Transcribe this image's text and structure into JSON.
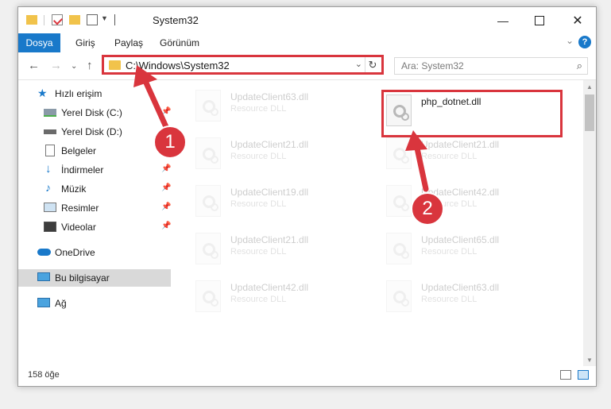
{
  "window": {
    "title": "System32"
  },
  "ribbon": {
    "tabs": [
      "Dosya",
      "Giriş",
      "Paylaş",
      "Görünüm"
    ],
    "help_label": "?"
  },
  "address": {
    "path": "C:\\Windows\\System32",
    "search_placeholder": "Ara: System32"
  },
  "nav": {
    "items": [
      {
        "label": "Hızlı erişim",
        "icon": "star-icon",
        "pinned": false
      },
      {
        "label": "Yerel Disk (C:)",
        "icon": "drive-icon",
        "pinned": true
      },
      {
        "label": "Yerel Disk (D:)",
        "icon": "drive-icon",
        "pinned": false
      },
      {
        "label": "Belgeler",
        "icon": "documents-icon",
        "pinned": true
      },
      {
        "label": "İndirmeler",
        "icon": "download-icon",
        "pinned": true
      },
      {
        "label": "Müzik",
        "icon": "music-icon",
        "pinned": true
      },
      {
        "label": "Resimler",
        "icon": "pictures-icon",
        "pinned": true
      },
      {
        "label": "Videolar",
        "icon": "videos-icon",
        "pinned": true
      },
      {
        "label": "OneDrive",
        "icon": "onedrive-icon",
        "pinned": false
      },
      {
        "label": "Bu bilgisayar",
        "icon": "computer-icon",
        "pinned": false
      },
      {
        "label": "Ağ",
        "icon": "network-icon",
        "pinned": false
      }
    ]
  },
  "files": {
    "left": [
      {
        "name": "UpdateClient63.dll",
        "type": "Resource DLL"
      },
      {
        "name": "UpdateClient21.dll",
        "type": "Resource DLL"
      },
      {
        "name": "UpdateClient19.dll",
        "type": "Resource DLL"
      },
      {
        "name": "UpdateClient21.dll",
        "type": "Resource DLL"
      },
      {
        "name": "UpdateClient42.dll",
        "type": "Resource DLL"
      }
    ],
    "right": [
      {
        "name": "php_dotnet.dll",
        "type": ""
      },
      {
        "name": "UpdateClient21.dll",
        "type": "Resource DLL"
      },
      {
        "name": "UpdateClient42.dll",
        "type": "Resource DLL"
      },
      {
        "name": "UpdateClient65.dll",
        "type": "Resource DLL"
      },
      {
        "name": "UpdateClient63.dll",
        "type": "Resource DLL"
      }
    ]
  },
  "status": {
    "item_count": "158 öğe"
  },
  "annotations": {
    "step1": "1",
    "step2": "2",
    "color": "#d9353d"
  },
  "colors": {
    "accent": "#1979ca",
    "highlight": "#d9353d",
    "folder": "#f1c34b"
  }
}
